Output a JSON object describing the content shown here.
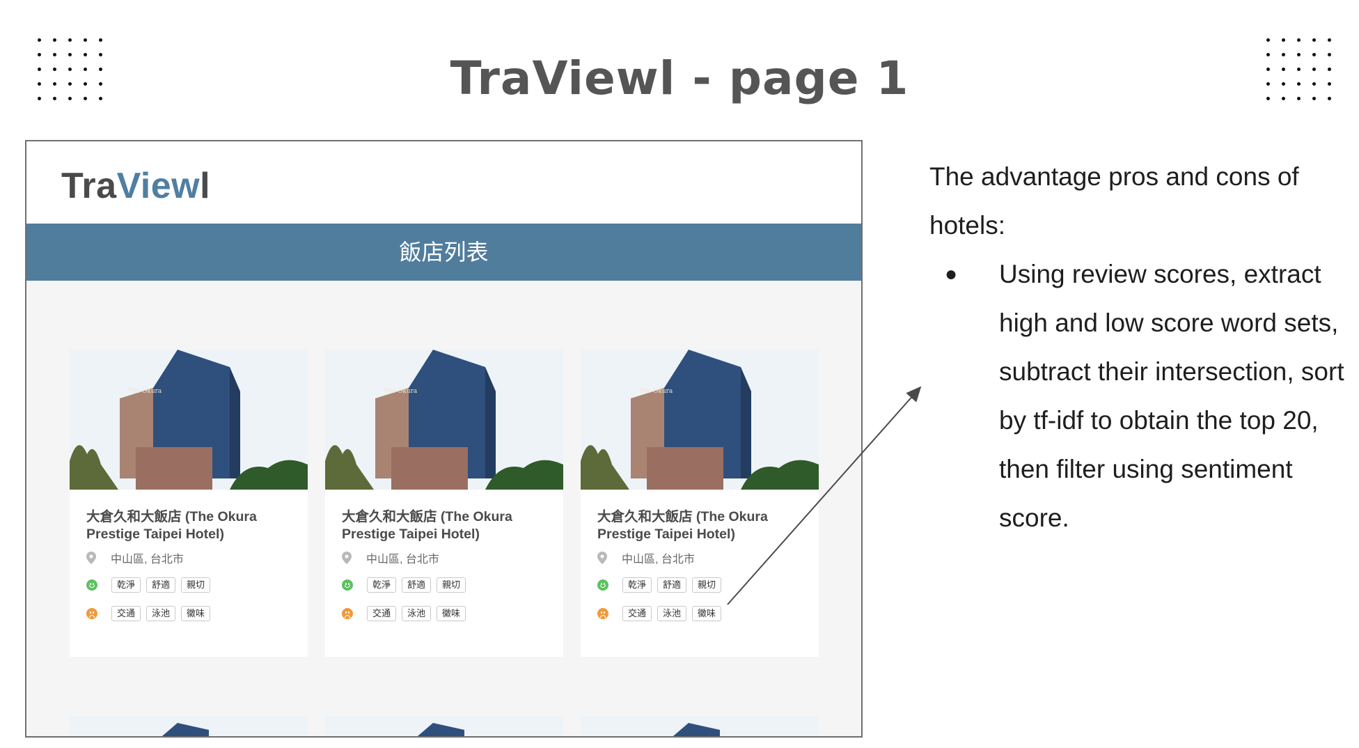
{
  "slide": {
    "title": "TraViewl - page 1"
  },
  "app": {
    "logo_part1": "Tra",
    "logo_part2": "View",
    "logo_part3": "l",
    "banner_title": "飯店列表"
  },
  "hotels": [
    {
      "name": "大倉久和大飯店 (The Okura Prestige Taipei Hotel)",
      "location": "中山區, 台北市",
      "pros": [
        "乾淨",
        "舒適",
        "親切"
      ],
      "cons": [
        "交通",
        "泳池",
        "黴味"
      ]
    },
    {
      "name": "大倉久和大飯店 (The Okura Prestige Taipei Hotel)",
      "location": "中山區, 台北市",
      "pros": [
        "乾淨",
        "舒適",
        "親切"
      ],
      "cons": [
        "交通",
        "泳池",
        "黴味"
      ]
    },
    {
      "name": "大倉久和大飯店 (The Okura Prestige Taipei Hotel)",
      "location": "中山區, 台北市",
      "pros": [
        "乾淨",
        "舒適",
        "親切"
      ],
      "cons": [
        "交通",
        "泳池",
        "黴味"
      ]
    }
  ],
  "explanation": {
    "intro": "The advantage pros and cons of hotels:",
    "bullets": [
      "Using review scores, extract high and low score word sets, subtract their intersection, sort by tf-idf to obtain the top 20, then filter using sentiment score."
    ]
  },
  "icons": {
    "location": "map-pin-icon",
    "pros": "smile-face-icon",
    "cons": "sad-face-icon",
    "bullet": "bullet-dot-icon"
  },
  "colors": {
    "title_gray": "#555555",
    "brand_blue": "#517d9d",
    "logo_blue": "#4f7fa2",
    "pros_green": "#5cc15f",
    "cons_orange": "#f09a3c"
  }
}
